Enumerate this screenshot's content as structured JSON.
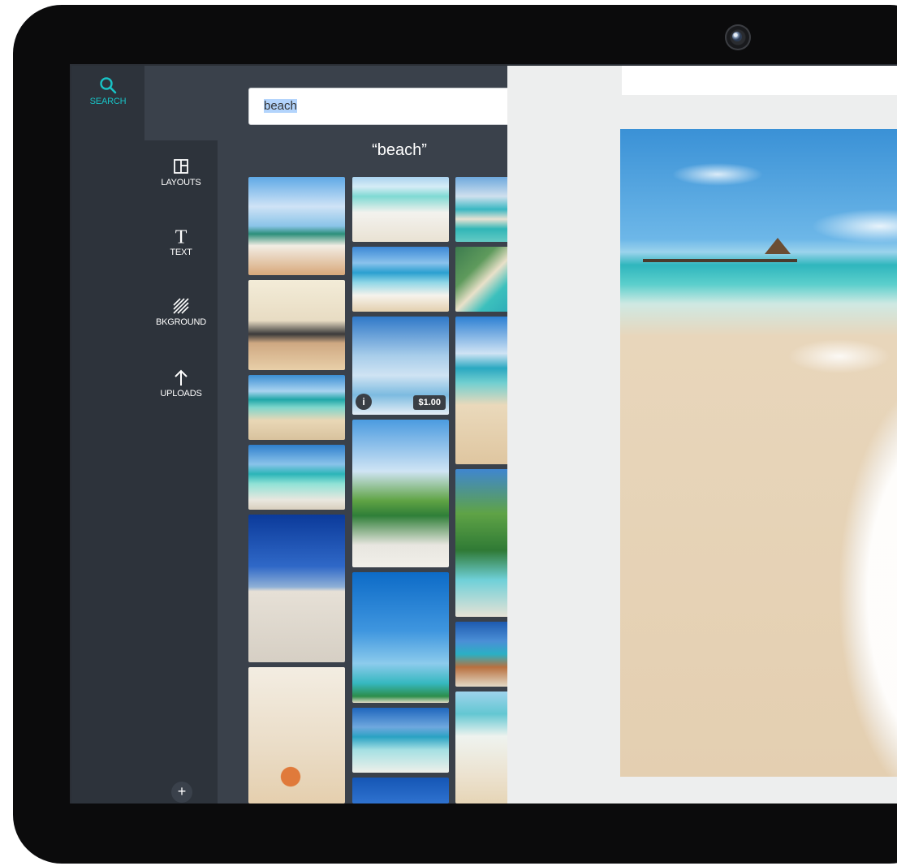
{
  "sidebar": {
    "items": [
      {
        "label": "SEARCH",
        "icon": "search-icon",
        "active": true
      },
      {
        "label": "LAYOUTS",
        "icon": "layouts-icon"
      },
      {
        "label": "TEXT",
        "icon": "text-icon"
      },
      {
        "label": "BKGROUND",
        "icon": "background-icon"
      },
      {
        "label": "UPLOADS",
        "icon": "upload-icon"
      }
    ],
    "add_label": "+"
  },
  "search": {
    "value": "beach"
  },
  "results": {
    "title": "“beach”",
    "priced_thumb": {
      "info": "i",
      "price": "$1.00"
    }
  },
  "colors": {
    "accent": "#19c2c5",
    "rail": "#2d333b",
    "panel": "#3a414b",
    "canvas": "#edeeee"
  }
}
